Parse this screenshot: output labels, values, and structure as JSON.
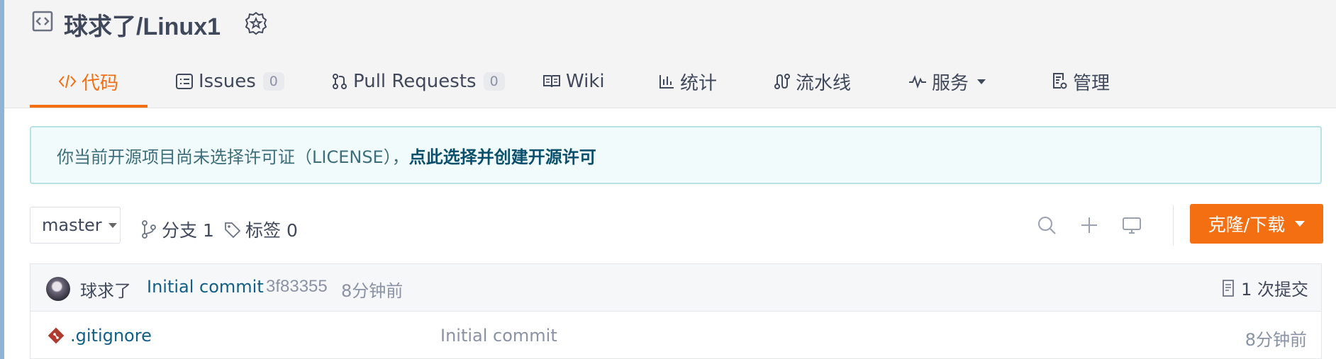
{
  "repo": {
    "owner": "球求了",
    "name": "/Linux1",
    "icon": "code-repo-icon",
    "badge_icon": "recommend-badge-icon"
  },
  "tabs": [
    {
      "label": "代码",
      "icon": "code-icon",
      "active": true
    },
    {
      "label": "Issues",
      "icon": "issues-icon",
      "count": "0"
    },
    {
      "label": "Pull Requests",
      "icon": "pull-request-icon",
      "count": "0"
    },
    {
      "label": "Wiki",
      "icon": "book-icon"
    },
    {
      "label": "统计",
      "icon": "bar-chart-icon"
    },
    {
      "label": "流水线",
      "icon": "pipeline-icon"
    },
    {
      "label": "服务",
      "icon": "pulse-icon",
      "has_dropdown": true
    },
    {
      "label": "管理",
      "icon": "settings-doc-icon"
    }
  ],
  "notice": {
    "text": "你当前开源项目尚未选择许可证（LICENSE），",
    "link": "点此选择并创建开源许可"
  },
  "toolbar": {
    "branch": "master",
    "branches_label": "分支 1",
    "tags_label": "标签 0",
    "clone_label": "克隆/下载",
    "icons": [
      "search-icon",
      "plus-icon",
      "monitor-icon"
    ]
  },
  "last_commit": {
    "author": "球求了",
    "message": "Initial commit",
    "sha": "3f83355",
    "time": "8分钟前",
    "count_label": "1 次提交"
  },
  "files": [
    {
      "name": ".gitignore",
      "message": "Initial commit",
      "time": "8分钟前",
      "icon": "git-icon"
    }
  ],
  "colors": {
    "accent": "#f46e12",
    "link": "#115f87",
    "notice_bg": "#f2fbfb",
    "notice_border": "#b7e3e8"
  }
}
